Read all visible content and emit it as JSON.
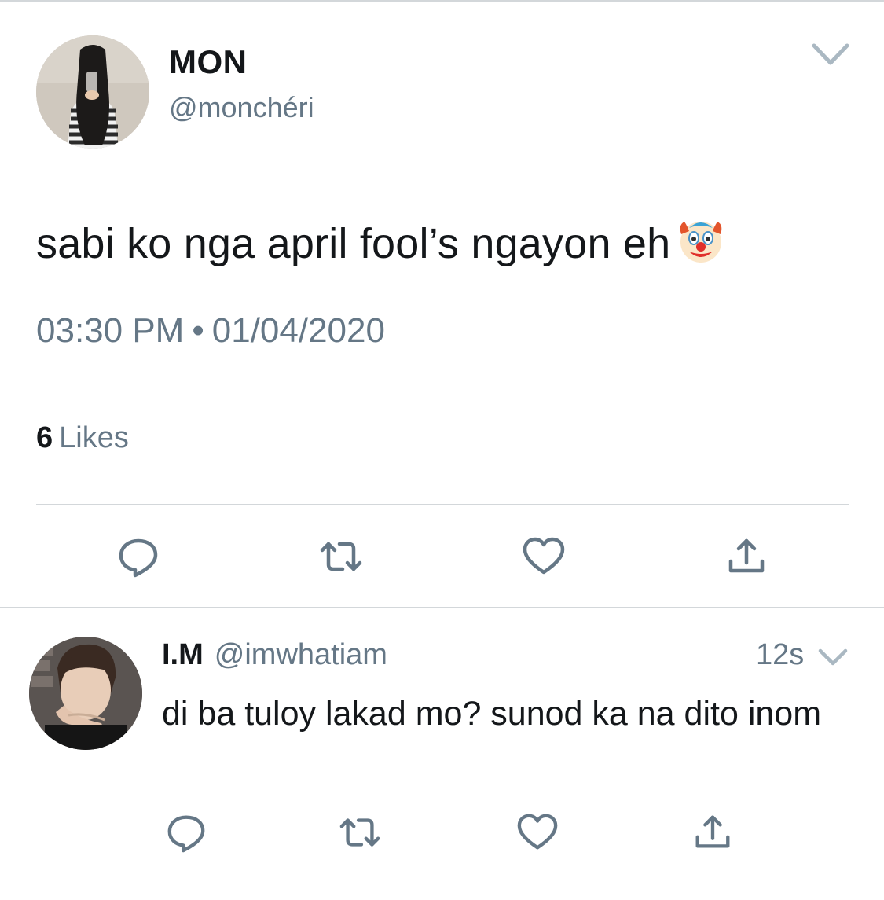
{
  "colors": {
    "text": "#14171a",
    "secondary": "#657786",
    "divider": "#d3d7da",
    "icon": "#657786"
  },
  "tweet": {
    "author_name": "MON",
    "author_handle": "@monchéri",
    "text": "sabi ko nga april fool’s ngayon eh",
    "emoji": "clown-face",
    "time": "03:30 PM",
    "separator": "•",
    "date": "01/04/2020",
    "likes_count": "6",
    "likes_label": "Likes",
    "actions": [
      "reply-icon",
      "retweet-icon",
      "like-icon",
      "share-icon"
    ]
  },
  "reply": {
    "author_name": "I.M",
    "author_handle": "@imwhatiam",
    "time": "12s",
    "text": "di ba tuloy lakad mo? sunod ka na dito inom",
    "actions": [
      "reply-icon",
      "retweet-icon",
      "like-icon",
      "share-icon"
    ]
  }
}
